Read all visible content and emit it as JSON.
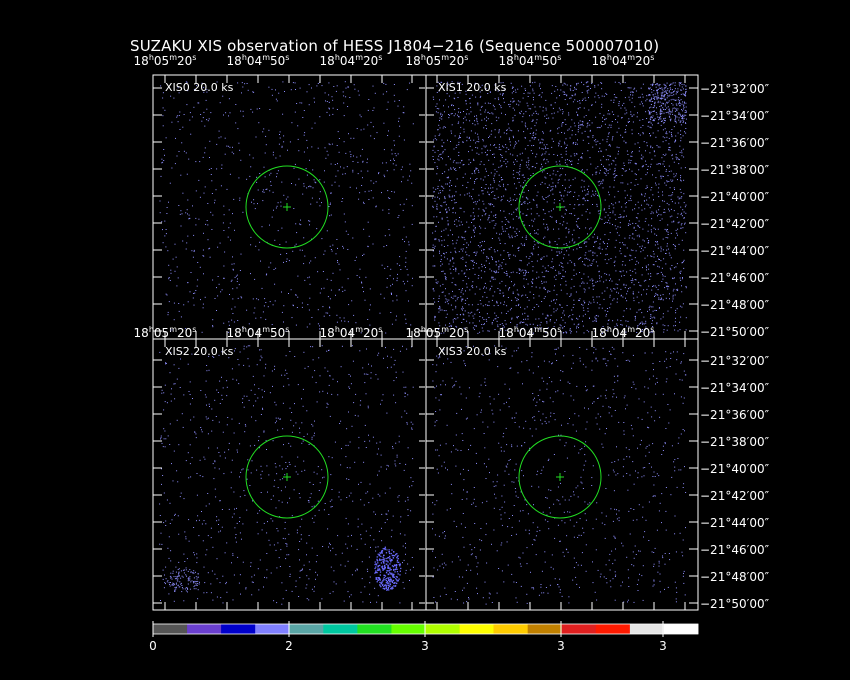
{
  "title": "SUZAKU XIS observation of HESS J1804−216  (Sequence 500007010)",
  "colors": {
    "background": "#000000",
    "frame": "#ffffff",
    "region": "#22dd22",
    "events": "#8f8fff"
  },
  "chart_data": {
    "type": "heatmap",
    "grid": false,
    "panels": [
      {
        "label": "XIS0 20.0 ks",
        "density": "low"
      },
      {
        "label": "XIS1 20.0 ks",
        "density": "high"
      },
      {
        "label": "XIS2 20.0 ks",
        "density": "low",
        "feature": "calibration sources in lower corners"
      },
      {
        "label": "XIS3 20.0 ks",
        "density": "low"
      }
    ],
    "ra_ticks": [
      "18^h05^m20^s",
      "18^h04^m50^s",
      "18^h04^m20^s"
    ],
    "dec_ticks": [
      "−21°32′00″",
      "−21°34′00″",
      "−21°36′00″",
      "−21°38′00″",
      "−21°40′00″",
      "−21°42′00″",
      "−21°44′00″",
      "−21°46′00″",
      "−21°48′00″",
      "−21°50′00″"
    ],
    "region": {
      "shape": "circle with center cross"
    },
    "colorbar": {
      "colors": [
        "#555555",
        "#6a3fcf",
        "#0000cc",
        "#8080ff",
        "#5aa6a6",
        "#00c8a0",
        "#22e022",
        "#66ff00",
        "#b0ff00",
        "#ffff00",
        "#ffcc00",
        "#c08000",
        "#e02020",
        "#ff1a00",
        "#e6e6e6",
        "#ffffff"
      ],
      "tick_labels": [
        "0",
        "2",
        "3",
        "3",
        "3"
      ]
    }
  }
}
